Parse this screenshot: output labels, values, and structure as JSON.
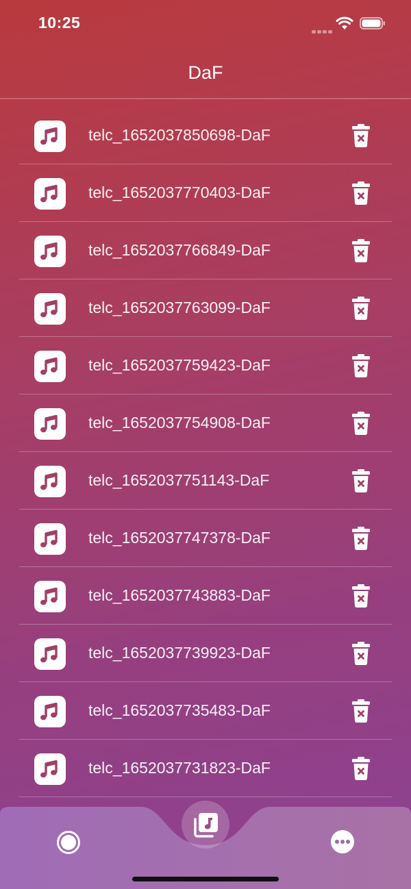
{
  "status_bar": {
    "time": "10:25"
  },
  "nav": {
    "title": "DaF"
  },
  "recordings": [
    {
      "title": "telc_1652037850698-DaF"
    },
    {
      "title": "telc_1652037770403-DaF"
    },
    {
      "title": "telc_1652037766849-DaF"
    },
    {
      "title": "telc_1652037763099-DaF"
    },
    {
      "title": "telc_1652037759423-DaF"
    },
    {
      "title": "telc_1652037754908-DaF"
    },
    {
      "title": "telc_1652037751143-DaF"
    },
    {
      "title": "telc_1652037747378-DaF"
    },
    {
      "title": "telc_1652037743883-DaF"
    },
    {
      "title": "telc_1652037739923-DaF"
    },
    {
      "title": "telc_1652037735483-DaF"
    },
    {
      "title": "telc_1652037731823-DaF"
    }
  ],
  "icons": {
    "row_leading": "music-note-icon",
    "row_trailing": "trash-icon",
    "tab_record": "record-icon",
    "tab_recordings": "music-library-icon",
    "tab_more": "more-icon"
  },
  "colors": {
    "gradient_top": "#b93a3d",
    "gradient_bottom": "#8b4293",
    "icon_tint": "#a13f65",
    "tab_bar": "#a474b4"
  }
}
